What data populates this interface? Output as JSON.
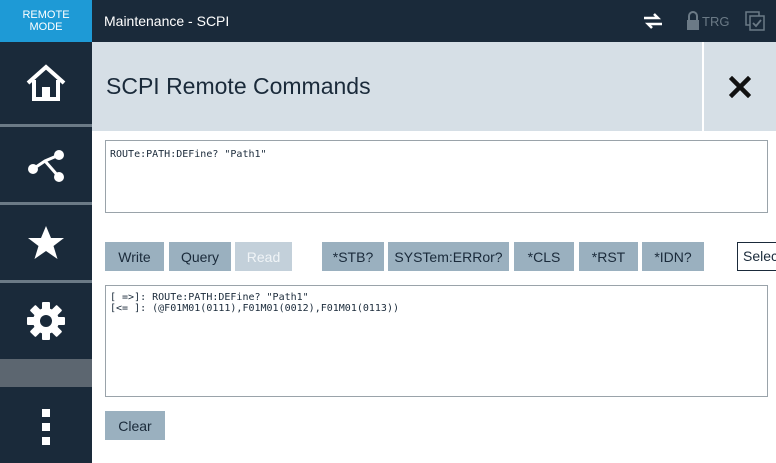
{
  "remote_mode": {
    "line1": "REMOTE",
    "line2": "MODE"
  },
  "topbar": {
    "title": "Maintenance - SCPI",
    "trg_label": "TRG"
  },
  "header": {
    "title": "SCPI Remote Commands"
  },
  "command_input": {
    "value": "ROUTe:PATH:DEFine? \"Path1\""
  },
  "buttons": {
    "write": "Write",
    "query": "Query",
    "read": "Read",
    "stb": "*STB?",
    "syst_err": "SYSTem:ERRor?",
    "cls": "*CLS",
    "rst": "*RST",
    "idn": "*IDN?"
  },
  "select": {
    "value": "Selec"
  },
  "output": {
    "lines": [
      "[ =>]: ROUTe:PATH:DEFine? \"Path1\"",
      "[<= ]: (@F01M01(0111),F01M01(0012),F01M01(0113))"
    ]
  },
  "clear_button": "Clear",
  "sidebar": {
    "items": [
      "home-icon",
      "path-icon",
      "star-icon",
      "gear-icon",
      "more-icon"
    ]
  },
  "colors": {
    "dark": "#1a2a3a",
    "accent": "#1e9ad6",
    "button": "#9ab0bf",
    "header": "#d6dfe6"
  }
}
